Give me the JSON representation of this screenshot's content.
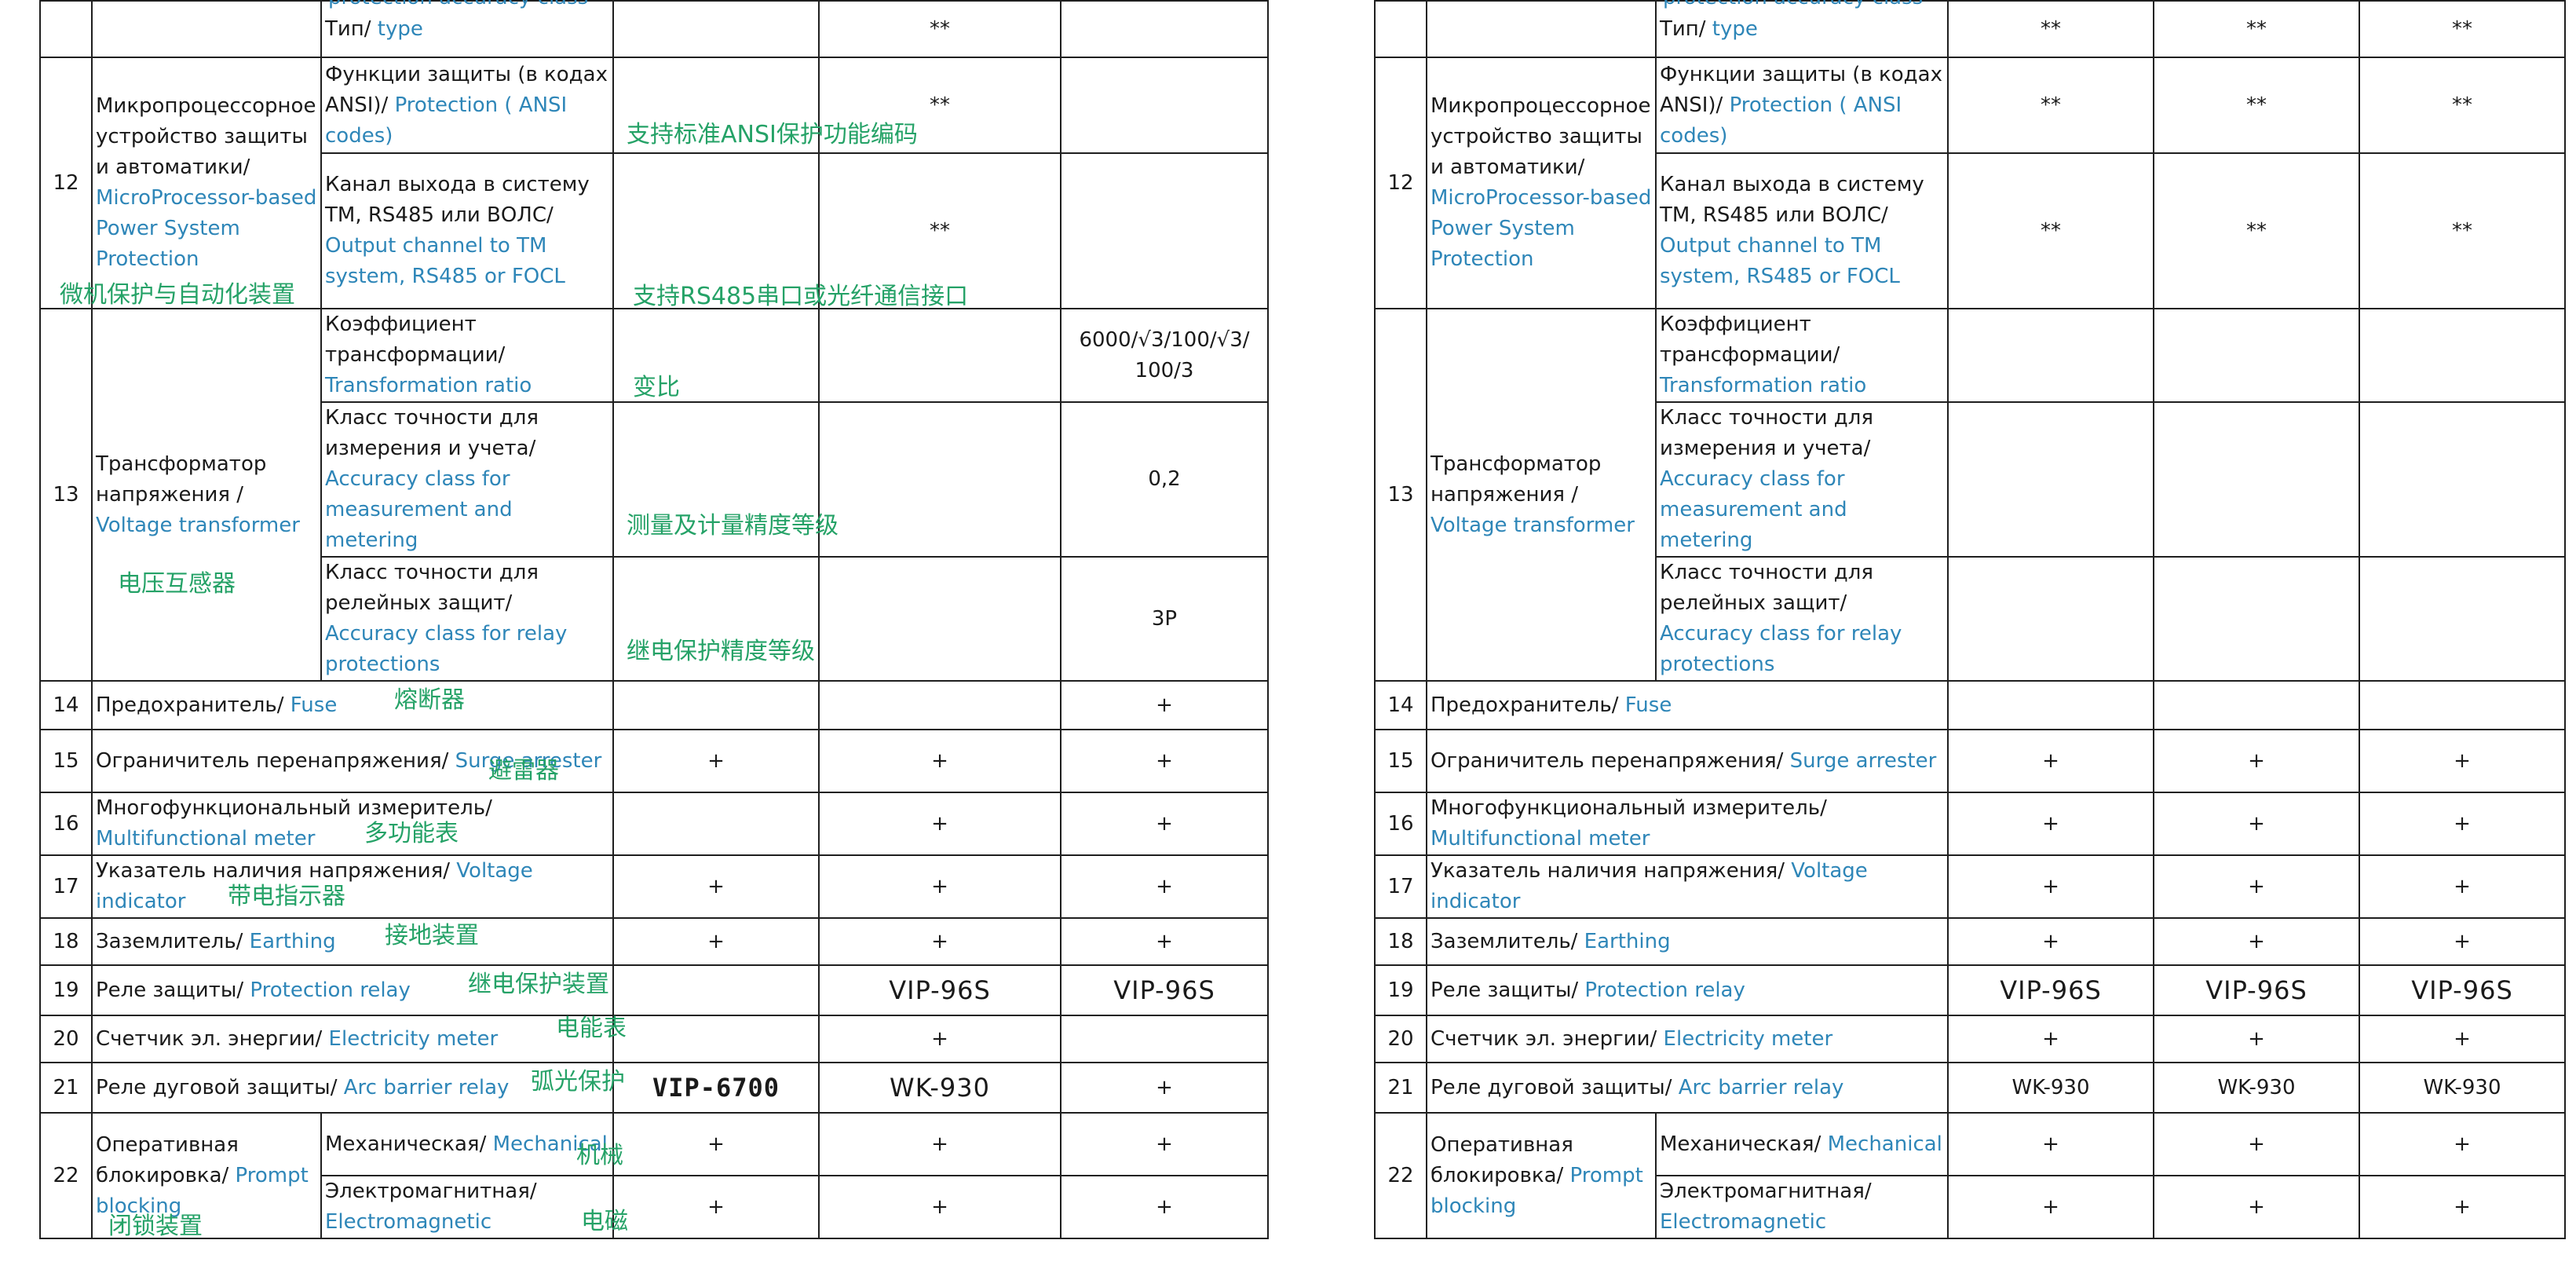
{
  "header_cut_text": "protection accuracy class",
  "rows": {
    "r11_type": {
      "ru": "Тип/",
      "en": " type"
    },
    "r12": {
      "num": "12",
      "name_ru": "Микропроцессорное устройство защиты и автоматики/",
      "name_en": " MicroProcessor-based Power System Protection",
      "name_zh": "微机保护与自动化装置",
      "sub1_ru": "Функции защиты (в кодах ANSI)/",
      "sub1_en": " Protection ( ANSI codes)",
      "sub1_zh": "支持标准ANSI保护功能编码",
      "sub2_ru": "Канал выхода в систему ТМ, RS485 или ВОЛС/",
      "sub2_en": " Output channel to TM system, RS485 or FOCL",
      "sub2_zh": "支持RS485串口或光纤通信接口"
    },
    "r13": {
      "num": "13",
      "name_ru": "Трансформатор напряжения /",
      "name_en": " Voltage transformer",
      "name_zh": "电压互感器",
      "sub1_ru": "Коэффициент трансформации/",
      "sub1_en": " Transformation ratio",
      "sub1_zh": "变比",
      "sub1_val": "6000/√3/100/√3/ 100/3",
      "sub2_ru": "Класс точности для измерения и учета/",
      "sub2_en": " Accuracy class for measurement and metering",
      "sub2_zh": "测量及计量精度等级",
      "sub2_val": "0,2",
      "sub3_ru": "Класс точности для релейных защит/",
      "sub3_en": " Accuracy class for relay protections",
      "sub3_zh": "继电保护精度等级",
      "sub3_val": "3P"
    },
    "r14": {
      "num": "14",
      "ru": "Предохранитель/",
      "en": " Fuse",
      "zh": "熔断器"
    },
    "r15": {
      "num": "15",
      "ru": "Ограничитель перенапряжения/",
      "en": " Surge arrester",
      "zh": "避雷器"
    },
    "r16": {
      "num": "16",
      "ru": "Многофункциональный измеритель/",
      "en": " Multifunctional meter",
      "zh": "多功能表"
    },
    "r17": {
      "num": "17",
      "ru": "Указатель наличия напряжения/",
      "en": " Voltage indicator",
      "zh": "带电指示器"
    },
    "r18": {
      "num": "18",
      "ru": "Заземлитель/",
      "en": " Earthing",
      "zh": "接地装置"
    },
    "r19": {
      "num": "19",
      "ru": "Реле защиты/",
      "en": " Protection relay",
      "zh": "继电保护装置"
    },
    "r20": {
      "num": "20",
      "ru": "Счетчик эл. энергии/",
      "en": " Electricity meter",
      "zh": "电能表"
    },
    "r21": {
      "num": "21",
      "ru": "Реле дуговой защиты/",
      "en": " Arc barrier relay",
      "zh": "弧光保护"
    },
    "r22": {
      "num": "22",
      "name_ru": "Оперативная блокировка/",
      "name_en": " Prompt blocking",
      "name_zh": "闭锁装置",
      "sub1_ru": "Механическая/",
      "sub1_en": " Mechanical",
      "sub1_zh": "机械",
      "sub2_ru": "Электромагнитная/",
      "sub2_en": " Electromagnetic",
      "sub2_zh": "电磁"
    }
  },
  "marks": {
    "star": "**",
    "plus": "+",
    "vip96": "VIP-96S",
    "vip6700": "VIP-6700",
    "wk930": "WK-930"
  }
}
